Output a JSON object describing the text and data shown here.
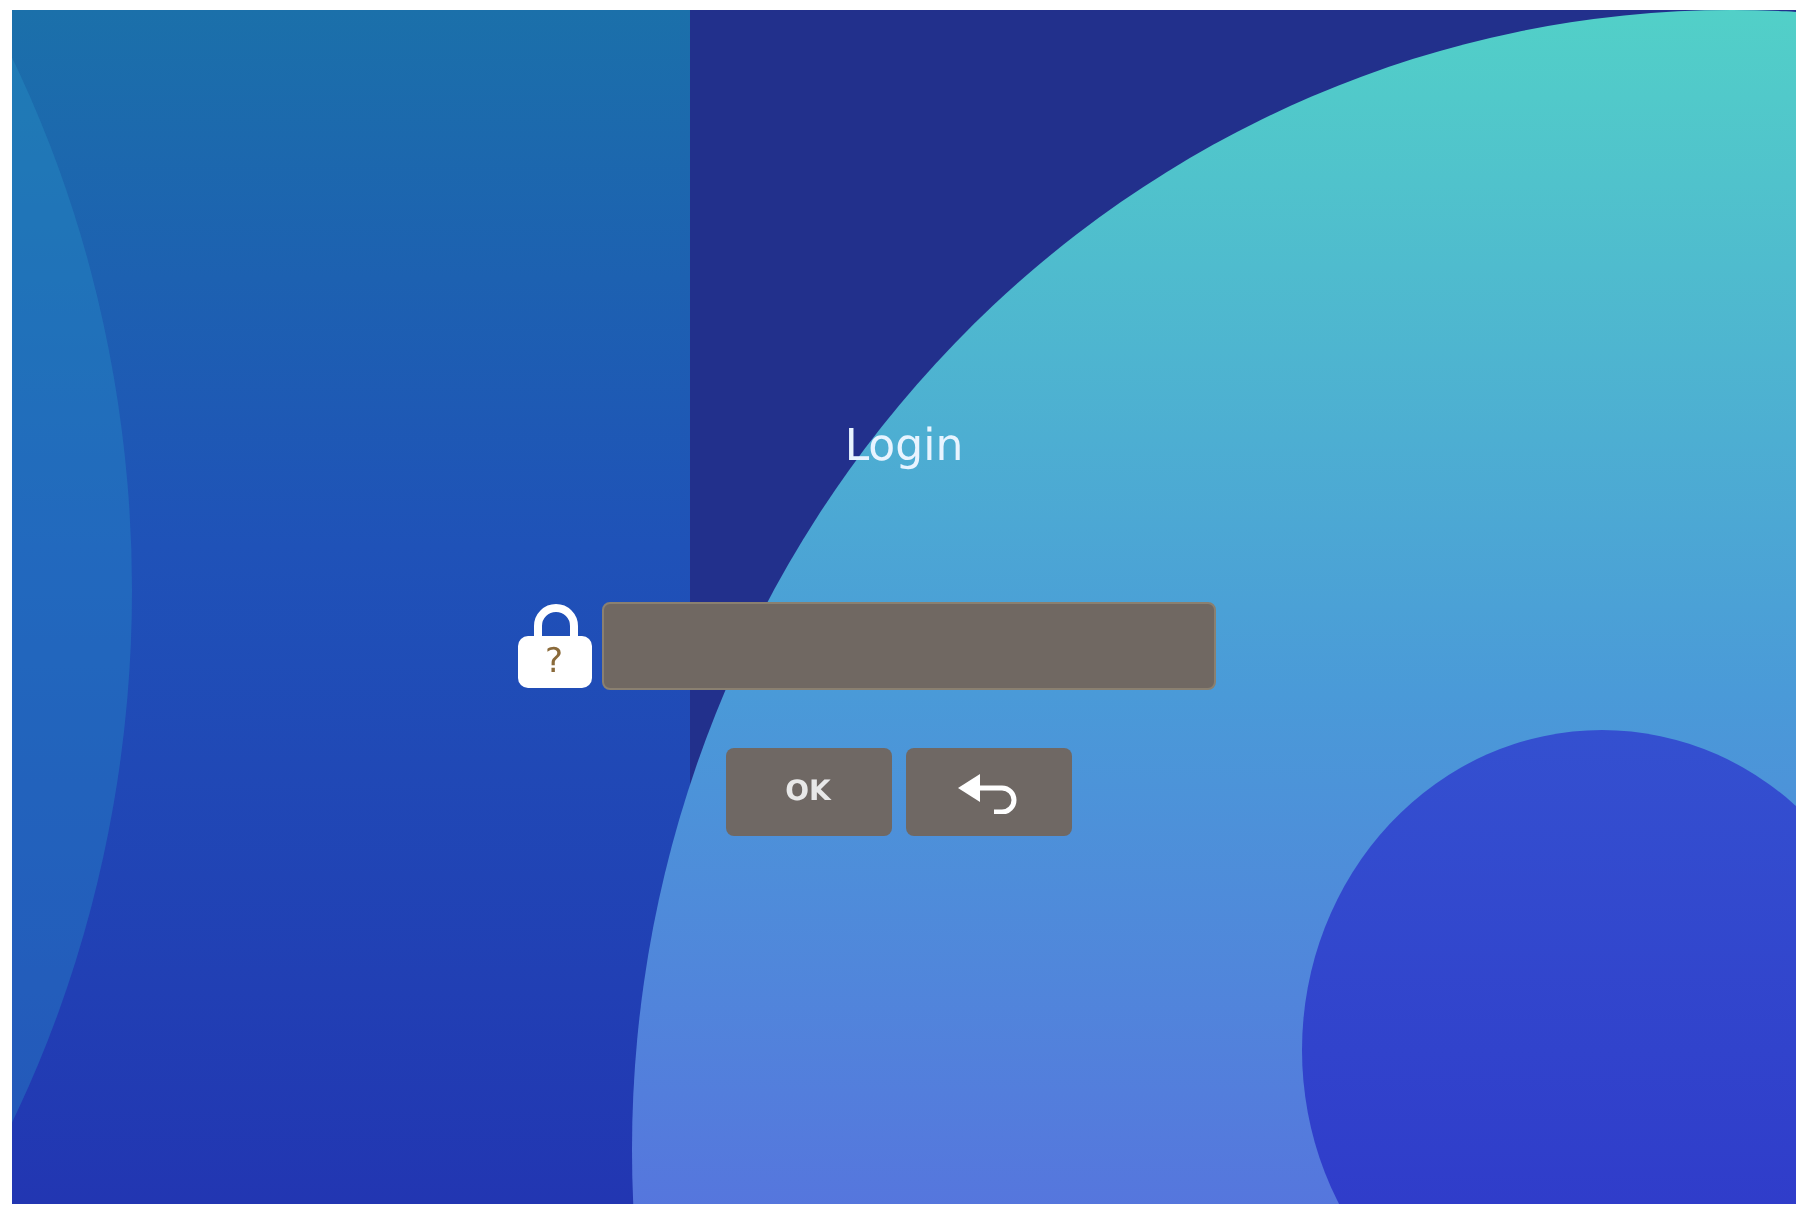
{
  "title": "Login",
  "lock_icon": {
    "mark": "?"
  },
  "buttons": [
    {
      "kind": "text",
      "label": "OK"
    },
    {
      "kind": "back"
    }
  ]
}
